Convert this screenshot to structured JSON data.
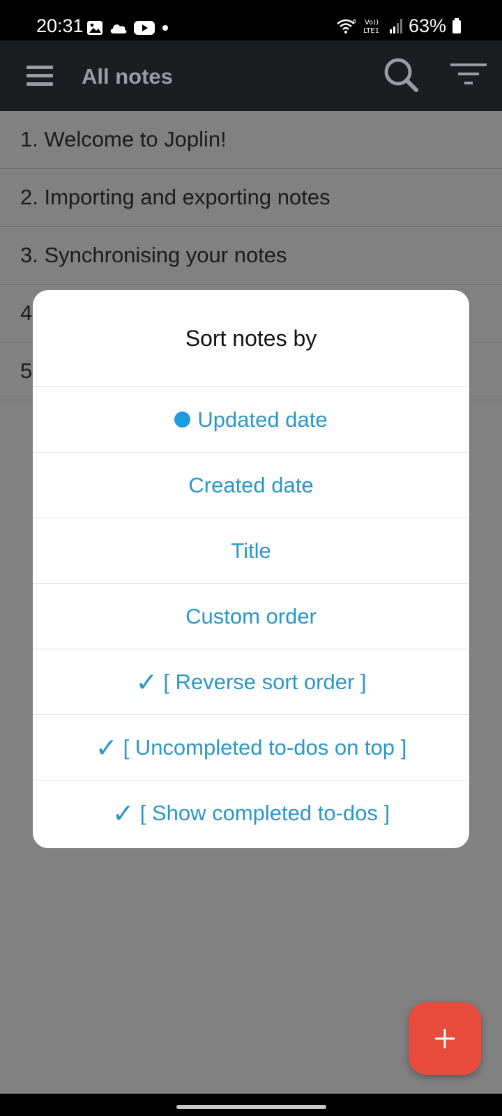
{
  "status_bar": {
    "time": "20:31",
    "battery": "63%",
    "left_icons": [
      "gallery-icon",
      "cloud-icon",
      "youtube-icon",
      "dot-icon"
    ],
    "right_icons": [
      "wifi-icon",
      "volte-icon",
      "signal-icon",
      "battery-icon"
    ]
  },
  "app_bar": {
    "title": "All notes",
    "menu_icon": "hamburger-icon",
    "search_icon": "search-icon",
    "sort_icon": "sort-icon"
  },
  "notes": [
    {
      "label": "1. Welcome to Joplin!"
    },
    {
      "label": "2. Importing and exporting notes"
    },
    {
      "label": "3. Synchronising your notes"
    },
    {
      "label": "4"
    },
    {
      "label": "5"
    }
  ],
  "dialog": {
    "title": "Sort notes by",
    "options": [
      {
        "label": "Updated date",
        "selected": true
      },
      {
        "label": "Created date"
      },
      {
        "label": "Title"
      },
      {
        "label": "Custom order"
      },
      {
        "label": "[ Reverse sort order ]",
        "checked": true
      },
      {
        "label": "[ Uncompleted to-dos on top ]",
        "checked": true
      },
      {
        "label": "[ Show completed to-dos ]",
        "checked": true
      }
    ],
    "check_mark": "✓"
  },
  "fab": {
    "label": "+",
    "icon": "add-icon"
  },
  "colors": {
    "accent": "#2b97c9",
    "radio": "#1e9be3",
    "fab": "#e74c3c",
    "app_bar": "#1b1d21",
    "overlay": "#818181"
  }
}
